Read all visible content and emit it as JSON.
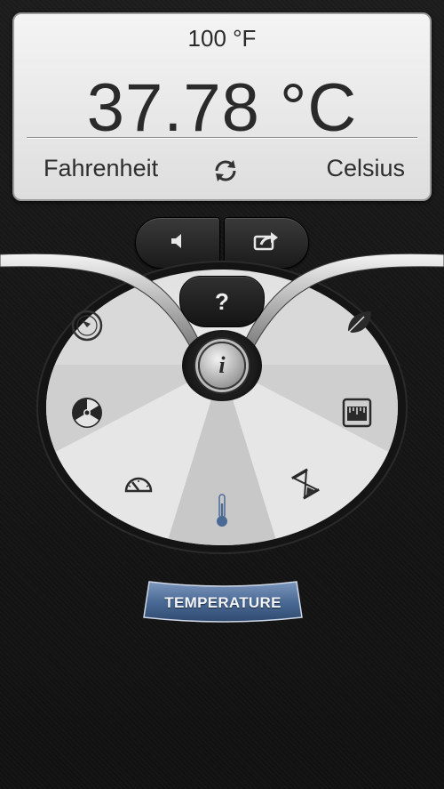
{
  "display": {
    "input": "100 °F",
    "result": "37.78 °C",
    "from_unit": "Fahrenheit",
    "to_unit": "Celsius"
  },
  "controls": {
    "help_label": "?",
    "info_label": "i"
  },
  "dial": {
    "selected": "thermometer",
    "categories": [
      "compass",
      "leaf",
      "radiation",
      "ruler-scale",
      "speedometer",
      "hourglass",
      "thermometer"
    ]
  },
  "category_label": "TEMPERATURE",
  "colors": {
    "accent": "#4a6a95",
    "dial_light": "#e9e9e9",
    "dial_dark": "#cfcfcf"
  }
}
